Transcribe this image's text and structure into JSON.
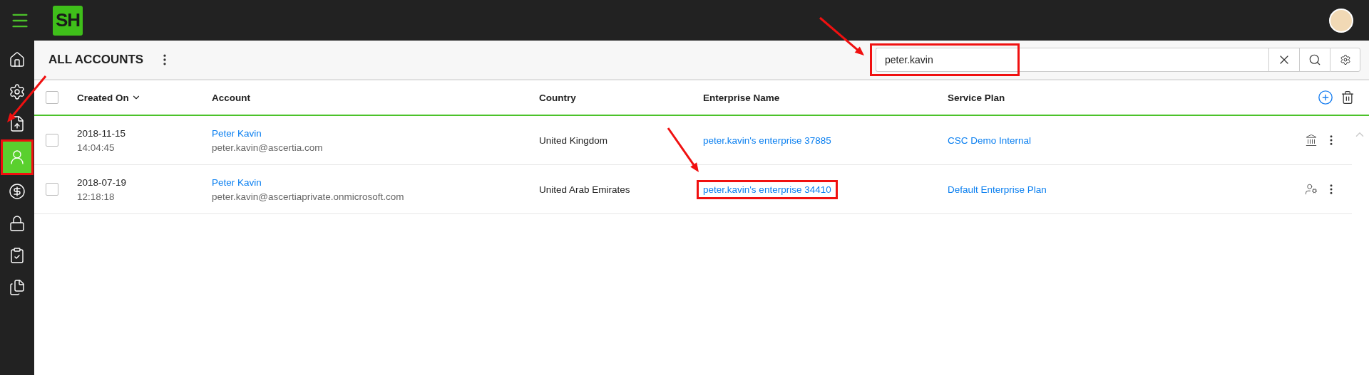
{
  "topbar": {
    "logo": "SH"
  },
  "nav": [
    {
      "kind": "home",
      "selected": false,
      "highlighted": false
    },
    {
      "kind": "settings",
      "selected": false,
      "highlighted": false
    },
    {
      "kind": "upload",
      "selected": false,
      "highlighted": false
    },
    {
      "kind": "user",
      "selected": true,
      "highlighted": true
    },
    {
      "kind": "billing",
      "selected": false,
      "highlighted": false
    },
    {
      "kind": "security",
      "selected": false,
      "highlighted": false
    },
    {
      "kind": "tasks",
      "selected": false,
      "highlighted": false
    },
    {
      "kind": "documents",
      "selected": false,
      "highlighted": false
    }
  ],
  "page": {
    "title": "ALL ACCOUNTS"
  },
  "search": {
    "value": "peter.kavin",
    "highlighted": true
  },
  "table": {
    "select_all_checked": false,
    "columns": [
      {
        "label": "Created On",
        "sorted": true
      },
      {
        "label": "Account",
        "sorted": false
      },
      {
        "label": "Country",
        "sorted": false
      },
      {
        "label": "Enterprise Name",
        "sorted": false
      },
      {
        "label": "Service Plan",
        "sorted": false
      }
    ],
    "rows": [
      {
        "checked": false,
        "date": "2018-11-15",
        "time": "14:04:45",
        "name": "Peter Kavin",
        "email": "peter.kavin@ascertia.com",
        "country": "United Kingdom",
        "enterprise": "peter.kavin's enterprise 37885",
        "enterprise_highlighted": false,
        "plan": "CSC Demo Internal",
        "kind": "bank"
      },
      {
        "checked": false,
        "date": "2018-07-19",
        "time": "12:18:18",
        "name": "Peter Kavin",
        "email": "peter.kavin@ascertiaprivate.onmicrosoft.com",
        "country": "United Arab Emirates",
        "enterprise": "peter.kavin's enterprise 34410",
        "enterprise_highlighted": true,
        "plan": "Default Enterprise Plan",
        "kind": "user"
      }
    ]
  }
}
